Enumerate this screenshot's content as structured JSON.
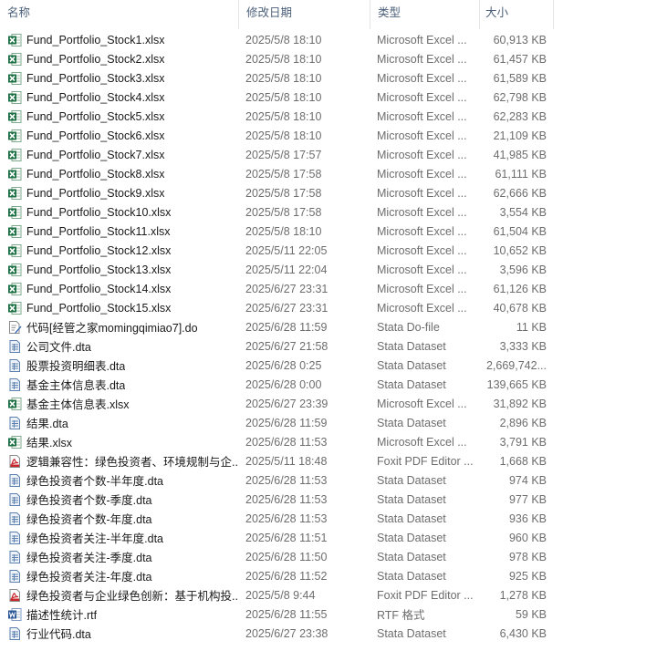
{
  "header": {
    "name_label": "名称",
    "date_label": "修改日期",
    "type_label": "类型",
    "size_label": "大小",
    "sort_indicator": "^"
  },
  "icon_colors": {
    "excel": "#1d7044",
    "stata": "#5b7fae",
    "pdf": "#c8272d",
    "rtf": "#2b5797",
    "do": "#3d6fb0"
  },
  "files": [
    {
      "name": "Fund_Portfolio_Stock1.xlsx",
      "date": "2025/5/8 18:10",
      "type": "Microsoft Excel ...",
      "size": "60,913 KB",
      "icon": "excel-icon"
    },
    {
      "name": "Fund_Portfolio_Stock2.xlsx",
      "date": "2025/5/8 18:10",
      "type": "Microsoft Excel ...",
      "size": "61,457 KB",
      "icon": "excel-icon"
    },
    {
      "name": "Fund_Portfolio_Stock3.xlsx",
      "date": "2025/5/8 18:10",
      "type": "Microsoft Excel ...",
      "size": "61,589 KB",
      "icon": "excel-icon"
    },
    {
      "name": "Fund_Portfolio_Stock4.xlsx",
      "date": "2025/5/8 18:10",
      "type": "Microsoft Excel ...",
      "size": "62,798 KB",
      "icon": "excel-icon"
    },
    {
      "name": "Fund_Portfolio_Stock5.xlsx",
      "date": "2025/5/8 18:10",
      "type": "Microsoft Excel ...",
      "size": "62,283 KB",
      "icon": "excel-icon"
    },
    {
      "name": "Fund_Portfolio_Stock6.xlsx",
      "date": "2025/5/8 18:10",
      "type": "Microsoft Excel ...",
      "size": "21,109 KB",
      "icon": "excel-icon"
    },
    {
      "name": "Fund_Portfolio_Stock7.xlsx",
      "date": "2025/5/8 17:57",
      "type": "Microsoft Excel ...",
      "size": "41,985 KB",
      "icon": "excel-icon"
    },
    {
      "name": "Fund_Portfolio_Stock8.xlsx",
      "date": "2025/5/8 17:58",
      "type": "Microsoft Excel ...",
      "size": "61,111 KB",
      "icon": "excel-icon"
    },
    {
      "name": "Fund_Portfolio_Stock9.xlsx",
      "date": "2025/5/8 17:58",
      "type": "Microsoft Excel ...",
      "size": "62,666 KB",
      "icon": "excel-icon"
    },
    {
      "name": "Fund_Portfolio_Stock10.xlsx",
      "date": "2025/5/8 17:58",
      "type": "Microsoft Excel ...",
      "size": "3,554 KB",
      "icon": "excel-icon"
    },
    {
      "name": "Fund_Portfolio_Stock11.xlsx",
      "date": "2025/5/8 18:10",
      "type": "Microsoft Excel ...",
      "size": "61,504 KB",
      "icon": "excel-icon"
    },
    {
      "name": "Fund_Portfolio_Stock12.xlsx",
      "date": "2025/5/11 22:05",
      "type": "Microsoft Excel ...",
      "size": "10,652 KB",
      "icon": "excel-icon"
    },
    {
      "name": "Fund_Portfolio_Stock13.xlsx",
      "date": "2025/5/11 22:04",
      "type": "Microsoft Excel ...",
      "size": "3,596 KB",
      "icon": "excel-icon"
    },
    {
      "name": "Fund_Portfolio_Stock14.xlsx",
      "date": "2025/6/27 23:31",
      "type": "Microsoft Excel ...",
      "size": "61,126 KB",
      "icon": "excel-icon"
    },
    {
      "name": "Fund_Portfolio_Stock15.xlsx",
      "date": "2025/6/27 23:31",
      "type": "Microsoft Excel ...",
      "size": "40,678 KB",
      "icon": "excel-icon"
    },
    {
      "name": "代码[经管之家momingqimiao7].do",
      "date": "2025/6/28 11:59",
      "type": "Stata Do-file",
      "size": "11 KB",
      "icon": "do-file-icon"
    },
    {
      "name": "公司文件.dta",
      "date": "2025/6/27 21:58",
      "type": "Stata Dataset",
      "size": "3,333 KB",
      "icon": "stata-dataset-icon"
    },
    {
      "name": "股票投资明细表.dta",
      "date": "2025/6/28 0:25",
      "type": "Stata Dataset",
      "size": "2,669,742...",
      "icon": "stata-dataset-icon"
    },
    {
      "name": "基金主体信息表.dta",
      "date": "2025/6/28 0:00",
      "type": "Stata Dataset",
      "size": "139,665 KB",
      "icon": "stata-dataset-icon"
    },
    {
      "name": "基金主体信息表.xlsx",
      "date": "2025/6/27 23:39",
      "type": "Microsoft Excel ...",
      "size": "31,892 KB",
      "icon": "excel-icon"
    },
    {
      "name": "结果.dta",
      "date": "2025/6/28 11:59",
      "type": "Stata Dataset",
      "size": "2,896 KB",
      "icon": "stata-dataset-icon"
    },
    {
      "name": "结果.xlsx",
      "date": "2025/6/28 11:53",
      "type": "Microsoft Excel ...",
      "size": "3,791 KB",
      "icon": "excel-icon"
    },
    {
      "name": "逻辑兼容性：绿色投资者、环境规制与企...",
      "date": "2025/5/11 18:48",
      "type": "Foxit PDF Editor ...",
      "size": "1,668 KB",
      "icon": "pdf-icon"
    },
    {
      "name": "绿色投资者个数-半年度.dta",
      "date": "2025/6/28 11:53",
      "type": "Stata Dataset",
      "size": "974 KB",
      "icon": "stata-dataset-icon"
    },
    {
      "name": "绿色投资者个数-季度.dta",
      "date": "2025/6/28 11:53",
      "type": "Stata Dataset",
      "size": "977 KB",
      "icon": "stata-dataset-icon"
    },
    {
      "name": "绿色投资者个数-年度.dta",
      "date": "2025/6/28 11:53",
      "type": "Stata Dataset",
      "size": "936 KB",
      "icon": "stata-dataset-icon"
    },
    {
      "name": "绿色投资者关注-半年度.dta",
      "date": "2025/6/28 11:51",
      "type": "Stata Dataset",
      "size": "960 KB",
      "icon": "stata-dataset-icon"
    },
    {
      "name": "绿色投资者关注-季度.dta",
      "date": "2025/6/28 11:50",
      "type": "Stata Dataset",
      "size": "978 KB",
      "icon": "stata-dataset-icon"
    },
    {
      "name": "绿色投资者关注-年度.dta",
      "date": "2025/6/28 11:52",
      "type": "Stata Dataset",
      "size": "925 KB",
      "icon": "stata-dataset-icon"
    },
    {
      "name": "绿色投资者与企业绿色创新：基于机构投...",
      "date": "2025/5/8 9:44",
      "type": "Foxit PDF Editor ...",
      "size": "1,278 KB",
      "icon": "pdf-icon"
    },
    {
      "name": "描述性统计.rtf",
      "date": "2025/6/28 11:55",
      "type": "RTF 格式",
      "size": "59 KB",
      "icon": "rtf-icon"
    },
    {
      "name": "行业代码.dta",
      "date": "2025/6/27 23:38",
      "type": "Stata Dataset",
      "size": "6,430 KB",
      "icon": "stata-dataset-icon"
    }
  ]
}
